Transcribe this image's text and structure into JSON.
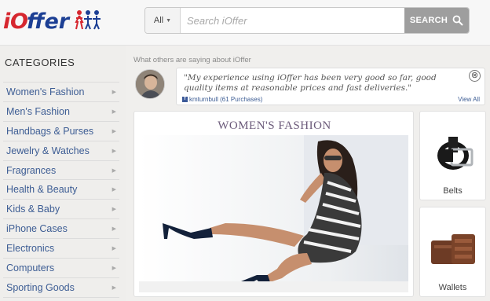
{
  "header": {
    "logo": "iOffer",
    "search_category": "All",
    "search_placeholder": "Search iOffer",
    "search_button": "SEARCH"
  },
  "sidebar": {
    "title": "CATEGORIES",
    "items": [
      {
        "label": "Women's Fashion"
      },
      {
        "label": "Men's Fashion"
      },
      {
        "label": "Handbags & Purses"
      },
      {
        "label": "Jewelry & Watches"
      },
      {
        "label": "Fragrances"
      },
      {
        "label": "Health & Beauty"
      },
      {
        "label": "Kids & Baby"
      },
      {
        "label": "iPhone Cases"
      },
      {
        "label": "Electronics"
      },
      {
        "label": "Computers"
      },
      {
        "label": "Sporting Goods"
      }
    ]
  },
  "testimonial": {
    "heading": "What others are saying about iOffer",
    "quote": "\"My experience using iOffer has been very good so far, good quality items at reasonable prices and fast deliveries.\"",
    "user": "kmturnbull (61 Purchases)",
    "view_all": "View All",
    "close": "⊗"
  },
  "promo": {
    "title": "WOMEN'S FASHION"
  },
  "tiles": {
    "belts": "Belts",
    "wallets": "Wallets"
  },
  "colors": {
    "brand_red": "#d6272f",
    "brand_blue": "#1c3f94",
    "link_blue": "#3d5d94",
    "search_button": "#9e9e9e"
  }
}
